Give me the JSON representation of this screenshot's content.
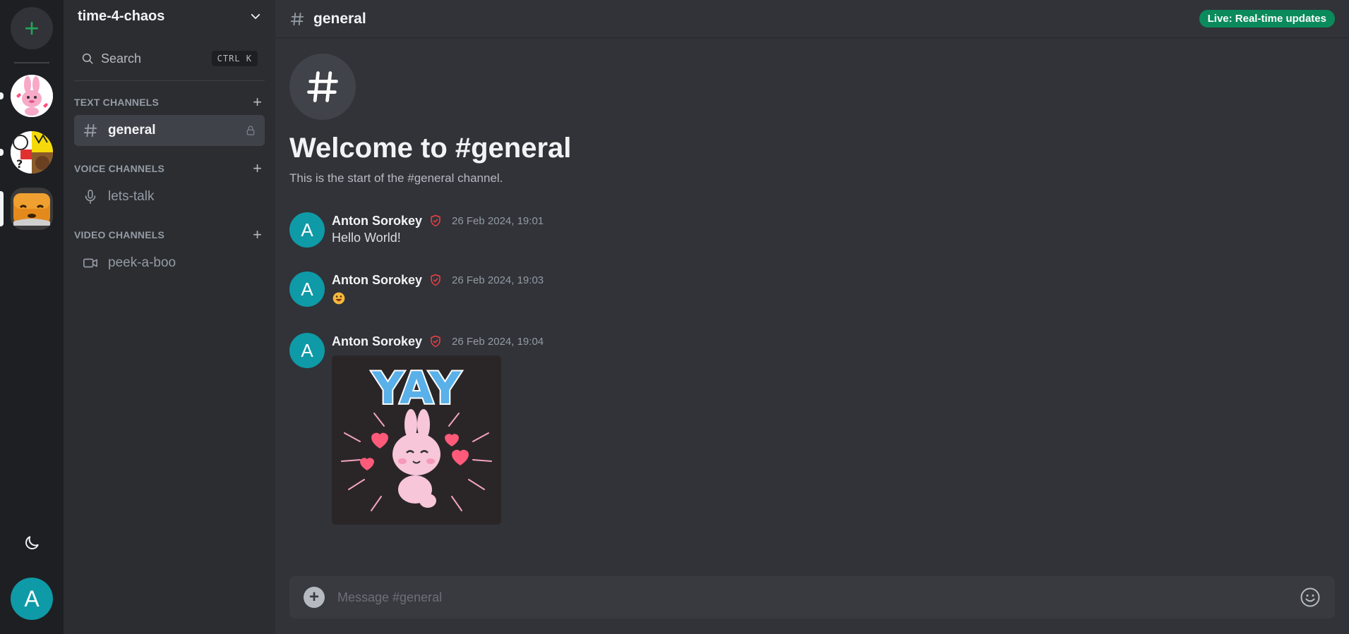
{
  "server": {
    "name": "time-4-chaos"
  },
  "search": {
    "label": "Search",
    "shortcut": "CTRL K"
  },
  "categories": {
    "text": {
      "label": "TEXT CHANNELS"
    },
    "voice": {
      "label": "VOICE CHANNELS"
    },
    "video": {
      "label": "VIDEO CHANNELS"
    }
  },
  "channels": {
    "text": [
      {
        "name": "general",
        "icon": "hash-icon",
        "locked": true
      }
    ],
    "voice": [
      {
        "name": "lets-talk",
        "icon": "microphone-icon"
      }
    ],
    "video": [
      {
        "name": "peek-a-boo",
        "icon": "video-camera-icon"
      }
    ]
  },
  "header": {
    "channel": "general",
    "live_badge": "Live: Real-time updates"
  },
  "welcome": {
    "title": "Welcome to #general",
    "subtitle": "This is the start of the #general channel."
  },
  "messages": [
    {
      "initial": "A",
      "author": "Anton Sorokey",
      "time": "26 Feb 2024, 19:01",
      "text": "Hello World!"
    },
    {
      "initial": "A",
      "author": "Anton Sorokey",
      "time": "26 Feb 2024, 19:03",
      "text": ""
    },
    {
      "initial": "A",
      "author": "Anton Sorokey",
      "time": "26 Feb 2024, 19:04",
      "text": ""
    }
  ],
  "sticker": {
    "text": "YAY"
  },
  "composer": {
    "placeholder": "Message #general"
  },
  "user": {
    "initial": "A"
  },
  "colors": {
    "accent_green": "#23a55a",
    "live_badge": "#0b8a5b",
    "avatar": "#0e9aa7",
    "mod_shield": "#f23f43"
  }
}
